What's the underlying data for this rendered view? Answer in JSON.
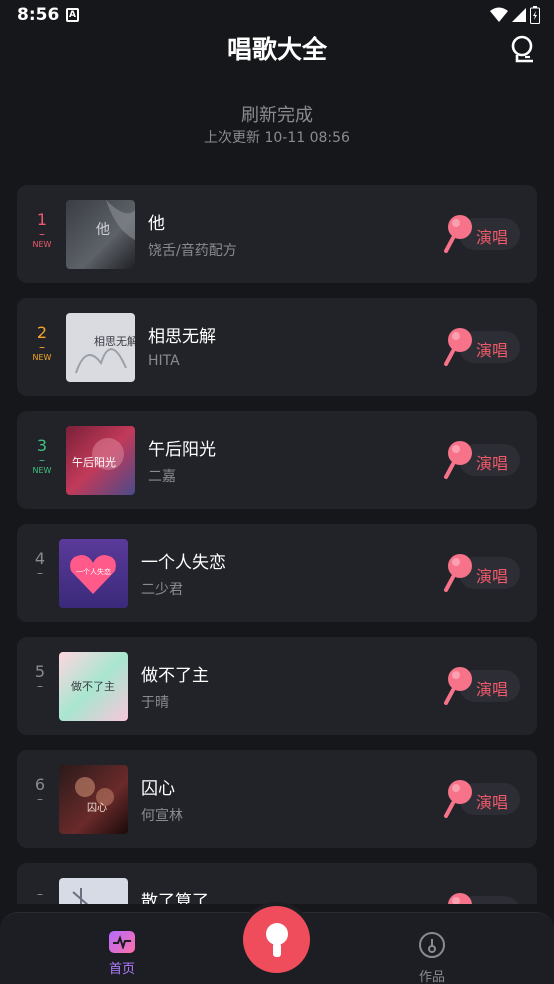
{
  "status_bar": {
    "time": "8:56",
    "a_badge": "A"
  },
  "header": {
    "title": "唱歌大全",
    "profile_icon": "profile-icon"
  },
  "refresh": {
    "title": "刷新完成",
    "last_update": "上次更新 10-11 08:56"
  },
  "sing_label": "演唱",
  "songs": [
    {
      "rank": "1",
      "dash": "–",
      "badge": "NEW",
      "title": "他",
      "artist": "饶舌/音药配方",
      "rank_color": "#ef5a6a"
    },
    {
      "rank": "2",
      "dash": "–",
      "badge": "NEW",
      "title": "相思无解",
      "artist": "HITA",
      "rank_color": "#f4a52a"
    },
    {
      "rank": "3",
      "dash": "–",
      "badge": "NEW",
      "title": "午后阳光",
      "artist": "二嘉",
      "rank_color": "#3fbf7f"
    },
    {
      "rank": "4",
      "dash": "–",
      "badge": "",
      "title": "一个人失恋",
      "artist": "二少君",
      "rank_color": "#8a8b90"
    },
    {
      "rank": "5",
      "dash": "–",
      "badge": "",
      "title": "做不了主",
      "artist": "于晴",
      "rank_color": "#8a8b90"
    },
    {
      "rank": "6",
      "dash": "–",
      "badge": "",
      "title": "囚心",
      "artist": "何宣林",
      "rank_color": "#8a8b90"
    },
    {
      "rank": "",
      "dash": "–",
      "badge": "",
      "title": "散了算了",
      "artist": "",
      "rank_color": "#8a8b90"
    }
  ],
  "cover_text": {
    "c1": "他",
    "c2": "相思无解",
    "c3": "午后阳光",
    "c4": "一个人失恋",
    "c5": "做不了主",
    "c6": "囚心"
  },
  "bottom_nav": {
    "home_label": "首页",
    "works_label": "作品"
  },
  "colors": {
    "accent": "#ef4d5c",
    "background": "#16171b",
    "card": "#222329"
  }
}
